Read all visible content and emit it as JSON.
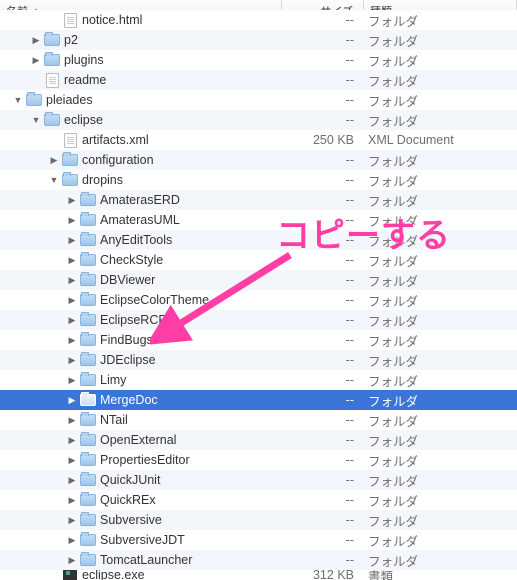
{
  "columns": {
    "name": "名前",
    "size": "サイズ",
    "kind": "種類"
  },
  "kinds": {
    "folder": "フォルダ",
    "xml": "XML Document",
    "document": "書類"
  },
  "sizes": {
    "none": "--",
    "artifacts": "250 KB",
    "eclipse_exe": "312 KB"
  },
  "annotation": "コピーする",
  "rows": [
    {
      "indent": 2,
      "tri": "none",
      "icon": "file",
      "name": "notice.html",
      "size": "sizes.none",
      "kind": "kinds.folder",
      "clip": true
    },
    {
      "indent": 1,
      "tri": "right",
      "icon": "folder",
      "name": "p2",
      "size": "sizes.none",
      "kind": "kinds.folder"
    },
    {
      "indent": 1,
      "tri": "right",
      "icon": "folder",
      "name": "plugins",
      "size": "sizes.none",
      "kind": "kinds.folder"
    },
    {
      "indent": 1,
      "tri": "none",
      "icon": "file",
      "name": "readme",
      "size": "sizes.none",
      "kind": "kinds.folder"
    },
    {
      "indent": 0,
      "tri": "down",
      "icon": "folder",
      "name": "pleiades",
      "size": "sizes.none",
      "kind": "kinds.folder"
    },
    {
      "indent": 1,
      "tri": "down",
      "icon": "folder",
      "name": "eclipse",
      "size": "sizes.none",
      "kind": "kinds.folder"
    },
    {
      "indent": 2,
      "tri": "none",
      "icon": "file",
      "name": "artifacts.xml",
      "size": "sizes.artifacts",
      "kind": "kinds.xml"
    },
    {
      "indent": 2,
      "tri": "right",
      "icon": "folder",
      "name": "configuration",
      "size": "sizes.none",
      "kind": "kinds.folder"
    },
    {
      "indent": 2,
      "tri": "down",
      "icon": "folder",
      "name": "dropins",
      "size": "sizes.none",
      "kind": "kinds.folder"
    },
    {
      "indent": 3,
      "tri": "right",
      "icon": "folder",
      "name": "AmaterasERD",
      "size": "sizes.none",
      "kind": "kinds.folder"
    },
    {
      "indent": 3,
      "tri": "right",
      "icon": "folder",
      "name": "AmaterasUML",
      "size": "sizes.none",
      "kind": "kinds.folder"
    },
    {
      "indent": 3,
      "tri": "right",
      "icon": "folder",
      "name": "AnyEditTools",
      "size": "sizes.none",
      "kind": "kinds.folder"
    },
    {
      "indent": 3,
      "tri": "right",
      "icon": "folder",
      "name": "CheckStyle",
      "size": "sizes.none",
      "kind": "kinds.folder"
    },
    {
      "indent": 3,
      "tri": "right",
      "icon": "folder",
      "name": "DBViewer",
      "size": "sizes.none",
      "kind": "kinds.folder"
    },
    {
      "indent": 3,
      "tri": "right",
      "icon": "folder",
      "name": "EclipseColorTheme",
      "size": "sizes.none",
      "kind": "kinds.folder"
    },
    {
      "indent": 3,
      "tri": "right",
      "icon": "folder",
      "name": "EclipseRCP",
      "size": "sizes.none",
      "kind": "kinds.folder"
    },
    {
      "indent": 3,
      "tri": "right",
      "icon": "folder",
      "name": "FindBugs",
      "size": "sizes.none",
      "kind": "kinds.folder"
    },
    {
      "indent": 3,
      "tri": "right",
      "icon": "folder",
      "name": "JDEclipse",
      "size": "sizes.none",
      "kind": "kinds.folder"
    },
    {
      "indent": 3,
      "tri": "right",
      "icon": "folder",
      "name": "Limy",
      "size": "sizes.none",
      "kind": "kinds.folder"
    },
    {
      "indent": 3,
      "tri": "right",
      "icon": "folder",
      "name": "MergeDoc",
      "size": "sizes.none",
      "kind": "kinds.folder",
      "selected": true
    },
    {
      "indent": 3,
      "tri": "right",
      "icon": "folder",
      "name": "NTail",
      "size": "sizes.none",
      "kind": "kinds.folder"
    },
    {
      "indent": 3,
      "tri": "right",
      "icon": "folder",
      "name": "OpenExternal",
      "size": "sizes.none",
      "kind": "kinds.folder"
    },
    {
      "indent": 3,
      "tri": "right",
      "icon": "folder",
      "name": "PropertiesEditor",
      "size": "sizes.none",
      "kind": "kinds.folder"
    },
    {
      "indent": 3,
      "tri": "right",
      "icon": "folder",
      "name": "QuickJUnit",
      "size": "sizes.none",
      "kind": "kinds.folder"
    },
    {
      "indent": 3,
      "tri": "right",
      "icon": "folder",
      "name": "QuickREx",
      "size": "sizes.none",
      "kind": "kinds.folder"
    },
    {
      "indent": 3,
      "tri": "right",
      "icon": "folder",
      "name": "Subversive",
      "size": "sizes.none",
      "kind": "kinds.folder"
    },
    {
      "indent": 3,
      "tri": "right",
      "icon": "folder",
      "name": "SubversiveJDT",
      "size": "sizes.none",
      "kind": "kinds.folder"
    },
    {
      "indent": 3,
      "tri": "right",
      "icon": "folder",
      "name": "TomcatLauncher",
      "size": "sizes.none",
      "kind": "kinds.folder"
    },
    {
      "indent": 2,
      "tri": "none",
      "icon": "exec",
      "name": "eclipse.exe",
      "size": "sizes.eclipse_exe",
      "kind": "kinds.document",
      "clipBottom": true
    }
  ]
}
